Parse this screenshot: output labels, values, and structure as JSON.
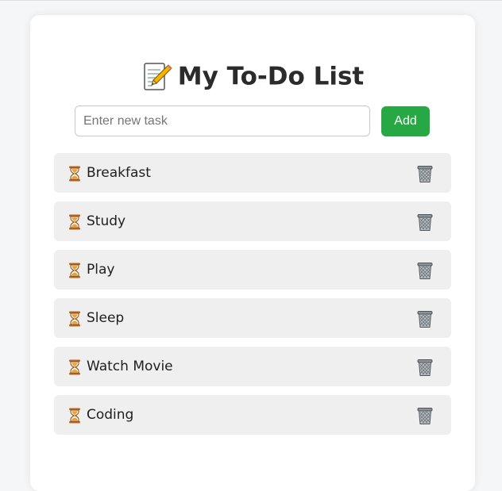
{
  "app": {
    "title": "My To-Do List",
    "title_icon": "memo-icon"
  },
  "form": {
    "input_value": "",
    "input_placeholder": "Enter new task",
    "add_label": "Add"
  },
  "colors": {
    "accent": "#28a745",
    "item_background": "#efefef"
  },
  "tasks": [
    {
      "status_icon": "hourglass-icon",
      "label": "Breakfast",
      "delete_icon": "trash-icon"
    },
    {
      "status_icon": "hourglass-icon",
      "label": "Study",
      "delete_icon": "trash-icon"
    },
    {
      "status_icon": "hourglass-icon",
      "label": "Play",
      "delete_icon": "trash-icon"
    },
    {
      "status_icon": "hourglass-icon",
      "label": "Sleep",
      "delete_icon": "trash-icon"
    },
    {
      "status_icon": "hourglass-icon",
      "label": "Watch Movie",
      "delete_icon": "trash-icon"
    },
    {
      "status_icon": "hourglass-icon",
      "label": "Coding",
      "delete_icon": "trash-icon"
    }
  ]
}
